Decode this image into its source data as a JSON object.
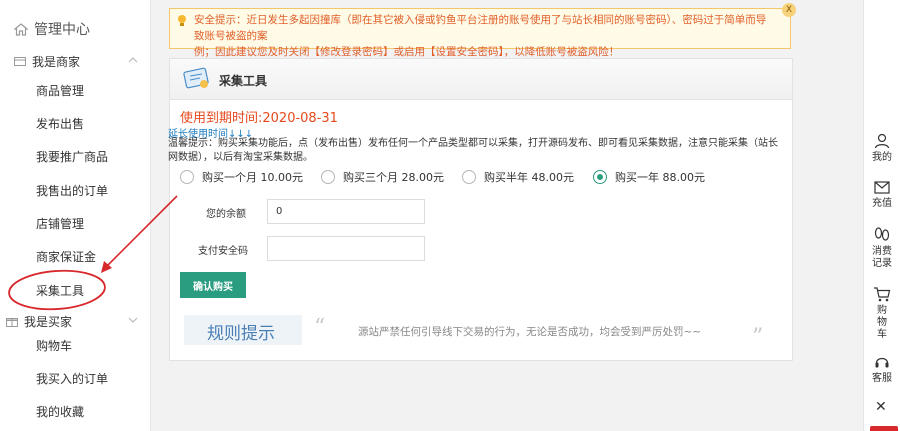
{
  "sidebar": {
    "title": "管理中心",
    "seller_section": "我是商家",
    "seller_items": [
      "商品管理",
      "发布出售",
      "我要推广商品",
      "我售出的订单",
      "店铺管理",
      "商家保证金",
      "采集工具"
    ],
    "buyer_section": "我是买家",
    "buyer_items": [
      "购物车",
      "我买入的订单",
      "我的收藏"
    ]
  },
  "notice": {
    "line1": "安全提示：近日发生多起因撞库（即在其它被入侵或钓鱼平台注册的账号使用了与站长相同的账号密码）、密码过于简单而导致账号被盗的案",
    "line2": "例；因此建议您及时关闭【修改登录密码】或启用【设置安全密码】，以降低账号被盗风险！",
    "close_label": "X"
  },
  "panel": {
    "title": "采集工具",
    "expiry": "使用到期时间:2020-08-31",
    "extend_link": "延长使用时间↓↓↓",
    "tip": "温馨提示：购买采集功能后，点（发布出售）发布任何一个产品类型都可以采集，打开源码发布、即可看见采集数据，注意只能采集（站长网数据），以后有淘宝采集数据。",
    "options": [
      {
        "label": "购买一个月 10.00元",
        "checked": false
      },
      {
        "label": "购买三个月 28.00元",
        "checked": false
      },
      {
        "label": "购买半年 48.00元",
        "checked": false
      },
      {
        "label": "购买一年 88.00元",
        "checked": true
      }
    ],
    "balance_label": "您的余额",
    "balance_value": "0",
    "password_label": "支付安全码",
    "password_value": "",
    "confirm_label": "确认购买",
    "rules_title": "规则提示",
    "rules_text": "源站严禁任何引导线下交易的行为，无论是否成功，均会受到严厉处罚~~",
    "quote_open": "“",
    "quote_close": "”"
  },
  "rightbar": {
    "mine": "我的",
    "recharge": "充值",
    "records_1": "消费",
    "records_2": "记录",
    "cart_1": "购",
    "cart_2": "物",
    "cart_3": "车",
    "service": "客服",
    "close": "✕"
  },
  "colors": {
    "accent_green": "#2a9c80",
    "warning_orange": "#e05f2a",
    "annotation_red": "#d7282c"
  }
}
